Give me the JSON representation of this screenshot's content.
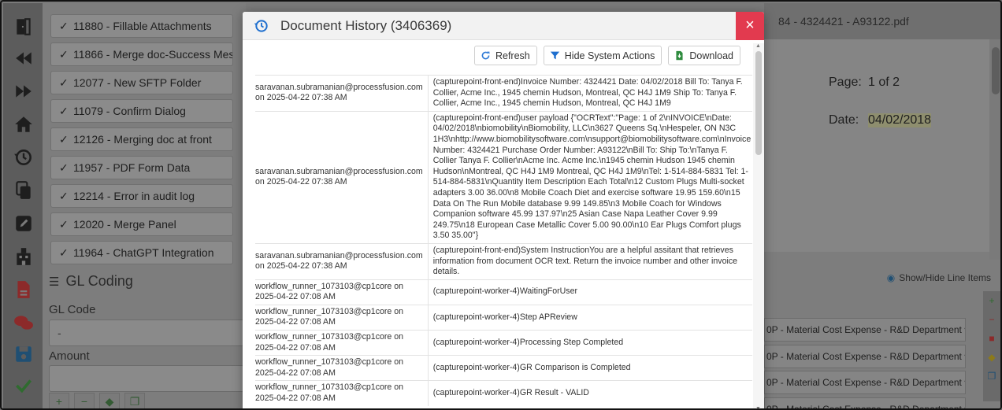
{
  "background": {
    "tasks": [
      {
        "label": "11880 - Fillable Attachments"
      },
      {
        "label": "11866 - Merge doc-Success Messag"
      },
      {
        "label": "12077 - New SFTP Folder"
      },
      {
        "label": "11079 - Confirm Dialog"
      },
      {
        "label": "12126 - Merging doc at front"
      },
      {
        "label": "11957 - PDF Form Data"
      },
      {
        "label": "12214 - Error in audit log"
      },
      {
        "label": "12020 - Merge Panel"
      },
      {
        "label": "11964 - ChatGPT Integration"
      }
    ],
    "gl_coding_title": "GL Coding",
    "gl_code_label": "GL Code",
    "gl_code_value": "-",
    "amount_label": "Amount",
    "doc_tab_title": "84 - 4324421 - A93122.pdf",
    "page_label": "Page:",
    "page_value": "1 of 2",
    "date_label": "Date:",
    "date_value": "04/02/2018",
    "show_hide_label": "Show/Hide Line Items",
    "gl_rows": [
      "0P - Material Cost Expense - R&D Department",
      "0P - Material Cost Expense - R&D Department",
      "0P - Material Cost Expense - R&D Department",
      "0P - Material Cost Expense - R&D Department"
    ]
  },
  "modal": {
    "title": "Document History (3406369)",
    "close_label": "×",
    "toolbar": {
      "refresh": "Refresh",
      "hide_system": "Hide System Actions",
      "download": "Download"
    },
    "rows": [
      {
        "who": "saravanan.subramanian@processfusion.com on 2025-04-22 07:38 AM",
        "what": "(capturepoint-front-end)Invoice Number: 4324421 Date: 04/02/2018 Bill To: Tanya F. Collier, Acme Inc., 1945 chemin Hudson, Montreal, QC H4J 1M9 Ship To: Tanya F. Collier, Acme Inc., 1945 chemin Hudson, Montreal, QC H4J 1M9"
      },
      {
        "who": "saravanan.subramanian@processfusion.com on 2025-04-22 07:38 AM",
        "what": "(capturepoint-front-end)user payload {\"OCRText\":\"Page: 1 of 2\\nINVOICE\\nDate: 04/02/2018\\nbiomobility\\nBiomobility, LLC\\n3627 Queens Sq.\\nHespeler, ON N3C 1H3\\nhttp://www.biomobilitysoftware.com\\nsupport@biomobilitysoftware.com\\nInvoice Number: 4324421 Purchase Order Number: A93122\\nBill To: Ship To:\\nTanya F. Collier Tanya F. Collier\\nAcme Inc. Acme Inc.\\n1945 chemin Hudson 1945 chemin Hudson\\nMontreal, QC H4J 1M9 Montreal, QC H4J 1M9\\nTel: 1-514-884-5831 Tel: 1-514-884-5831\\nQuantity Item Description Each Total\\n12 Custom Plugs Multi-socket adapters 3.00 36.00\\n8 Mobile Coach Diet and exercise software 19.95 159.60\\n15 Data On The Run Mobile database 9.99 149.85\\n3 Mobile Coach for Windows Companion software 45.99 137.97\\n25 Asian Case Napa Leather Cover 9.99 249.75\\n18 European Case Metallic Cover 5.00 90.00\\n10 Ear Plugs Comfort plugs 3.50 35.00\"}"
      },
      {
        "who": "saravanan.subramanian@processfusion.com on 2025-04-22 07:38 AM",
        "what": "(capturepoint-front-end)System InstructionYou are a helpful assitant that retrieves information from document OCR text. Return the invoice number and other invoice details."
      },
      {
        "who": "workflow_runner_1073103@cp1core on 2025-04-22 07:08 AM",
        "what": "(capturepoint-worker-4)WaitingForUser"
      },
      {
        "who": "workflow_runner_1073103@cp1core on 2025-04-22 07:08 AM",
        "what": "(capturepoint-worker-4)Step APReview"
      },
      {
        "who": "workflow_runner_1073103@cp1core on 2025-04-22 07:08 AM",
        "what": "(capturepoint-worker-4)Processing Step Completed"
      },
      {
        "who": "workflow_runner_1073103@cp1core on 2025-04-22 07:08 AM",
        "what": "(capturepoint-worker-4)GR Comparison is Completed"
      },
      {
        "who": "workflow_runner_1073103@cp1core on 2025-04-22 07:08 AM",
        "what": "(capturepoint-worker-4)GR Result - VALID"
      }
    ]
  },
  "colors": {
    "close_red": "#e23a4f",
    "refresh_blue": "#2f7bd6",
    "filter_blue": "#1e6fcf",
    "download_green": "#2e8b3e"
  }
}
